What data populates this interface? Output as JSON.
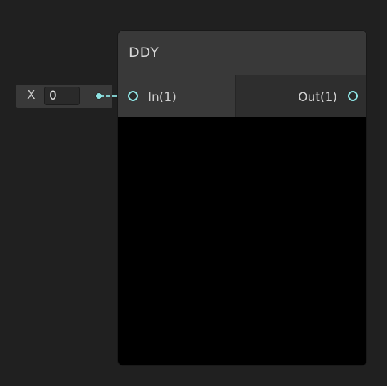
{
  "node": {
    "title": "DDY",
    "input_port": {
      "label": "In(1)"
    },
    "output_port": {
      "label": "Out(1)"
    }
  },
  "inline_field": {
    "label": "X",
    "value": "0"
  },
  "colors": {
    "canvas_background": "#202020",
    "node_header": "#393939",
    "port_accent": "#8fe5e5",
    "preview_background": "#000000"
  }
}
